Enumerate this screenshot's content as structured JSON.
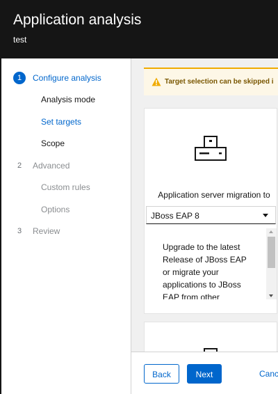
{
  "header": {
    "title": "Application analysis",
    "subtitle": "test"
  },
  "nav": {
    "steps": [
      {
        "number": "1",
        "label": "Configure analysis",
        "state": "current",
        "substeps": [
          {
            "label": "Analysis mode",
            "state": "visited"
          },
          {
            "label": "Set targets",
            "state": "current"
          },
          {
            "label": "Scope",
            "state": "enabled"
          }
        ]
      },
      {
        "number": "2",
        "label": "Advanced",
        "state": "disabled",
        "substeps": [
          {
            "label": "Custom rules",
            "state": "disabled"
          },
          {
            "label": "Options",
            "state": "disabled"
          }
        ]
      },
      {
        "number": "3",
        "label": "Review",
        "state": "disabled",
        "substeps": []
      }
    ]
  },
  "alert": {
    "text": "Target selection can be skipped i",
    "icon": "warning-triangle-icon",
    "color": "#f0ab00"
  },
  "target_card": {
    "icon": "server-icon",
    "heading": "Application server migration to",
    "select": {
      "value": "JBoss EAP 8"
    },
    "description": "Upgrade to the latest Release of JBoss EAP or migrate your applications to JBoss EAP from other"
  },
  "second_card": {
    "icon": "server-icon"
  },
  "footer": {
    "back_label": "Back",
    "next_label": "Next",
    "cancel_label": "Cance"
  },
  "colors": {
    "accent": "#0066cc",
    "header_bg": "#151515",
    "warning": "#f0ab00"
  }
}
